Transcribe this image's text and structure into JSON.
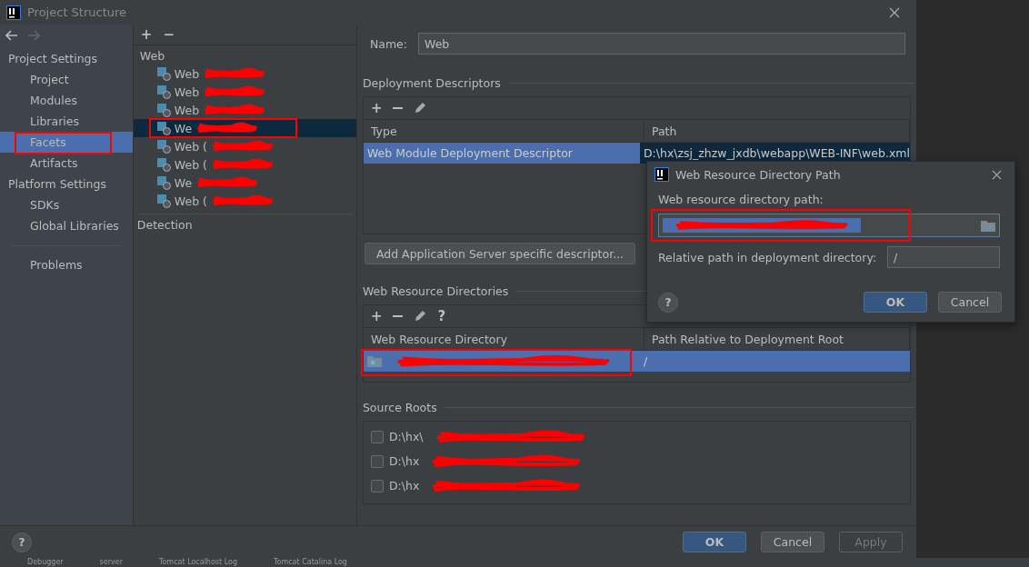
{
  "window": {
    "title": "Project Structure"
  },
  "sidebar": {
    "groups": [
      {
        "heading": "Project Settings",
        "items": [
          {
            "label": "Project",
            "selected": false,
            "annotated": false
          },
          {
            "label": "Modules",
            "selected": false,
            "annotated": false
          },
          {
            "label": "Libraries",
            "selected": false,
            "annotated": false
          },
          {
            "label": "Facets",
            "selected": true,
            "annotated": true
          },
          {
            "label": "Artifacts",
            "selected": false,
            "annotated": false
          }
        ]
      },
      {
        "heading": "Platform Settings",
        "items": [
          {
            "label": "SDKs",
            "selected": false,
            "annotated": false
          },
          {
            "label": "Global Libraries",
            "selected": false,
            "annotated": false
          }
        ]
      }
    ],
    "footer_items": [
      {
        "label": "Problems",
        "selected": false,
        "annotated": false
      }
    ]
  },
  "facets": {
    "toolbar": [
      "+",
      "−"
    ],
    "heading": "Web",
    "items": [
      {
        "label": "Web",
        "selected": false,
        "annotated": false,
        "redacted": true
      },
      {
        "label": "Web",
        "selected": false,
        "annotated": false,
        "redacted": true
      },
      {
        "label": "Web",
        "selected": false,
        "annotated": false,
        "redacted": true
      },
      {
        "label": "We",
        "selected": true,
        "annotated": true,
        "redacted": true
      },
      {
        "label": "Web (",
        "selected": false,
        "annotated": false,
        "redacted": true
      },
      {
        "label": "Web (",
        "selected": false,
        "annotated": false,
        "redacted": true
      },
      {
        "label": "We",
        "selected": false,
        "annotated": false,
        "redacted": true
      },
      {
        "label": "Web (",
        "selected": false,
        "annotated": false,
        "redacted": true
      }
    ],
    "detection": "Detection"
  },
  "name": {
    "label": "Name:",
    "value": "Web"
  },
  "deployment_descriptors": {
    "title": "Deployment Descriptors",
    "toolbar_add": "+",
    "columns": [
      "Type",
      "Path"
    ],
    "rows": [
      {
        "cells": [
          "Web Module Deployment Descriptor",
          "D:\\hx\\zsj_zhzw_jxdb\\webapp\\WEB-INF\\web.xml"
        ],
        "selected": true
      }
    ],
    "add_button": "Add Application Server specific descriptor..."
  },
  "web_resource_directories": {
    "title": "Web Resource Directories",
    "toolbar_add": "+",
    "toolbar_help": "?",
    "columns": [
      "Web Resource Directory",
      "Path Relative to Deployment Root"
    ],
    "rows": [
      {
        "cells": [
          "",
          "/"
        ],
        "selected": true,
        "annotated": true,
        "redacted": true
      }
    ]
  },
  "source_roots": {
    "title": "Source Roots",
    "items": [
      {
        "label": "D:\\hx\\",
        "checked": false,
        "redacted": true
      },
      {
        "label": "D:\\hx",
        "checked": false,
        "redacted": true
      },
      {
        "label": "D:\\hx",
        "checked": false,
        "redacted": true
      }
    ]
  },
  "footer": {
    "help": "?",
    "buttons": [
      {
        "label": "OK",
        "kind": "default",
        "disabled": false
      },
      {
        "label": "Cancel",
        "kind": "normal",
        "disabled": false
      },
      {
        "label": "Apply",
        "kind": "normal",
        "disabled": true
      }
    ]
  },
  "dialog": {
    "title": "Web Resource Directory Path",
    "field_label": "Web resource directory path:",
    "field_annotated": true,
    "field_redacted": true,
    "relative_label": "Relative path in deployment directory:",
    "relative_value": "/",
    "help": "?",
    "buttons": [
      {
        "label": "OK",
        "kind": "default",
        "disabled": false
      },
      {
        "label": "Cancel",
        "kind": "normal",
        "disabled": false
      }
    ]
  },
  "tool_tabs": [
    "Debugger",
    "server",
    "Tomcat Localhost Log",
    "Tomcat Catalina Log"
  ]
}
